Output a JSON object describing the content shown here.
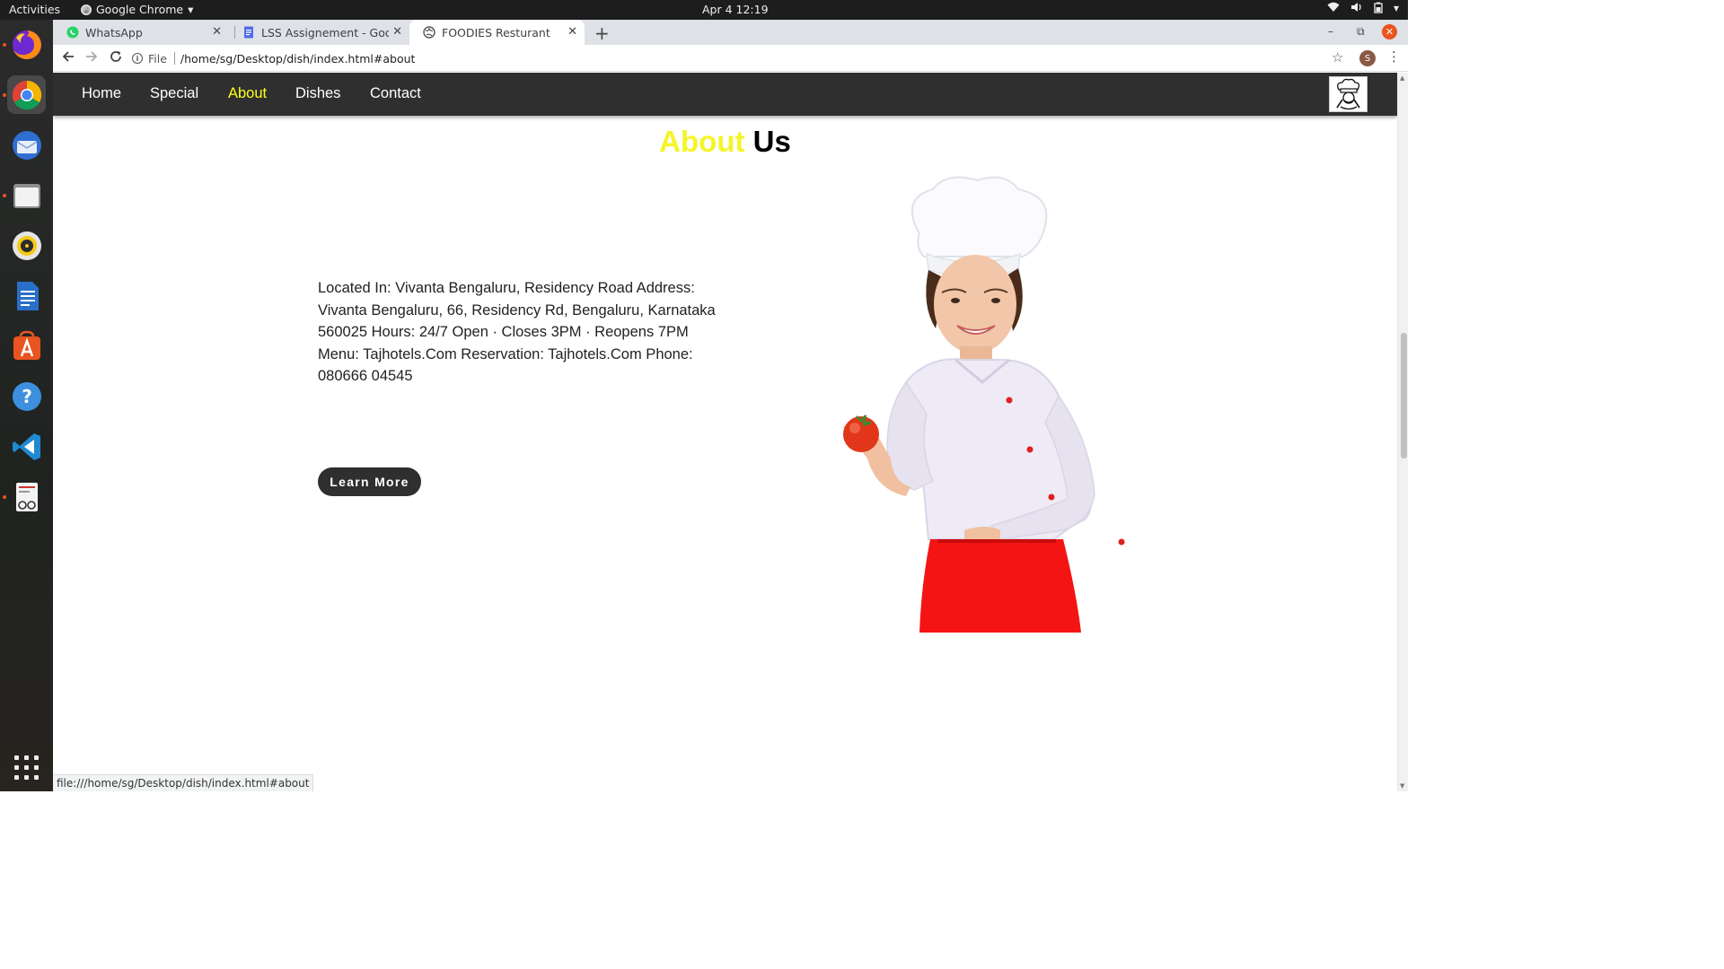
{
  "system": {
    "activities": "Activities",
    "app_name": "Google Chrome",
    "clock": "Apr 4  12:19"
  },
  "browser": {
    "tabs": [
      {
        "title": "WhatsApp",
        "icon": "whatsapp-icon",
        "color": "#25d366"
      },
      {
        "title": "LSS Assignement - Google Docs",
        "icon": "google-docs-icon",
        "color": "#4f6bed"
      },
      {
        "title": "FOODIES Resturant",
        "icon": "globe-icon",
        "color": "#555555"
      }
    ],
    "address": {
      "scheme": "File",
      "url": "/home/sg/Desktop/dish/index.html#about"
    },
    "profile_initial": "S",
    "status_url": "file:///home/sg/Desktop/dish/index.html#about"
  },
  "site": {
    "nav": [
      "Home",
      "Special",
      "About",
      "Dishes",
      "Contact"
    ],
    "active_nav": "About",
    "accent_color": "#ffff1a",
    "about": {
      "heading_highlight": "About",
      "heading_rest": "Us",
      "text": "Located In: Vivanta Bengaluru, Residency Road Address: Vivanta Bengaluru, 66, Residency Rd, Bengaluru, Karnataka 560025 Hours: 24/7 Open · Closes 3PM · Reopens 7PM Menu: Tajhotels.Com Reservation: Tajhotels.Com Phone: 080666 04545",
      "button": "Learn More"
    }
  }
}
